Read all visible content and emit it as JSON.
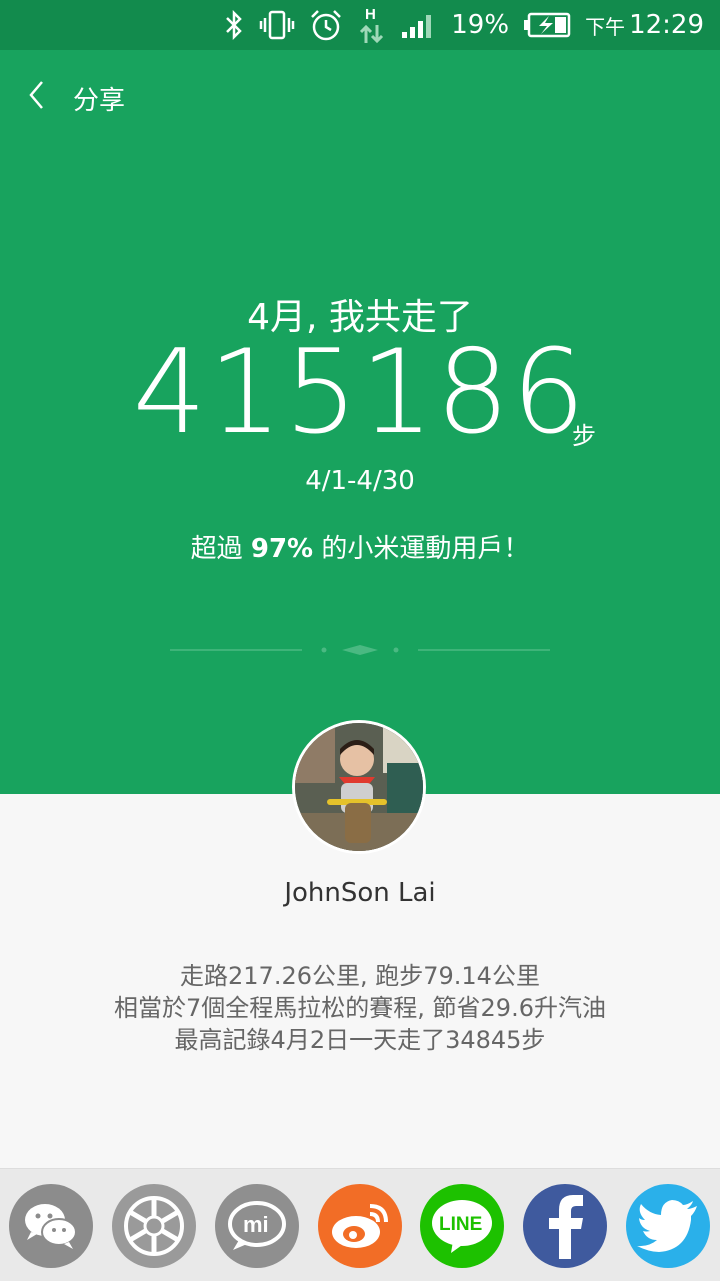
{
  "status_bar": {
    "network_type": "H",
    "battery_percent": "19%",
    "time_period": "下午",
    "time": "12:29",
    "icons": [
      "bluetooth-icon",
      "vibrate-icon",
      "alarm-icon",
      "data-transfer-icon",
      "signal-icon",
      "battery-charging-icon"
    ]
  },
  "nav": {
    "back_icon": "chevron-left-icon",
    "title": "分享"
  },
  "summary": {
    "headline": "4月, 我共走了",
    "steps": "415186",
    "unit": "步",
    "date_range": "4/1-4/30",
    "percent_prefix": "超過 ",
    "percent_value": "97%",
    "percent_suffix": " 的小米運動用戶！"
  },
  "user": {
    "name": "JohnSon Lai"
  },
  "stats": {
    "line1": "走路217.26公里, 跑步79.14公里",
    "line2": "相當於7個全程馬拉松的賽程, 節省29.6升汽油",
    "line3": "最高記錄4月2日一天走了34845步"
  },
  "share_targets": [
    {
      "icon": "wechat-icon",
      "color": "#8c8c8c"
    },
    {
      "icon": "camera-shutter-icon",
      "color": "#9a9a9a"
    },
    {
      "icon": "mi-icon",
      "color": "#8f8f8f"
    },
    {
      "icon": "weibo-icon",
      "color": "#f26d26"
    },
    {
      "icon": "line-icon",
      "color": "#1dc100"
    },
    {
      "icon": "facebook-icon",
      "color": "#3f5a9e"
    },
    {
      "icon": "twitter-icon",
      "color": "#2ab0ea"
    }
  ],
  "colors": {
    "status_bar": "#128b4d",
    "header_green": "#18a35e",
    "background": "#f7f7f7",
    "share_bar": "#e9e9e9"
  }
}
